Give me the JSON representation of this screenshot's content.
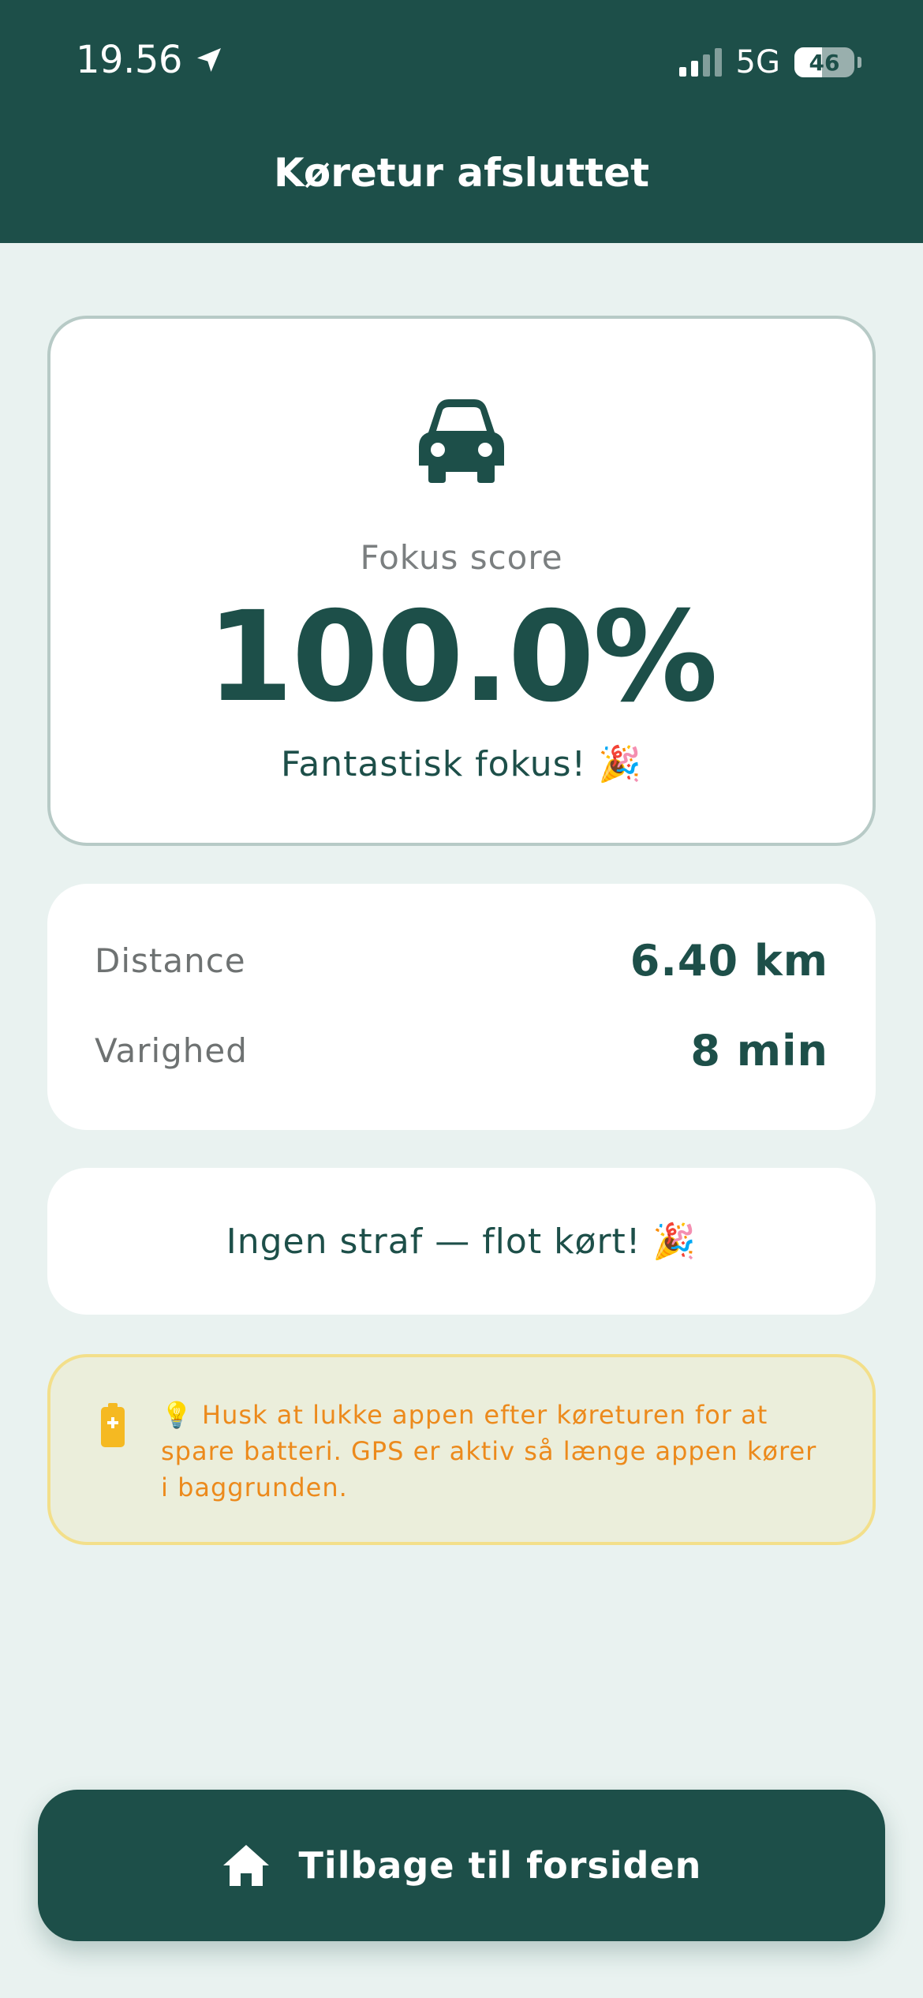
{
  "status_bar": {
    "time": "19.56",
    "network": "5G",
    "battery_percent": "46",
    "battery_level": 0.46,
    "signal_bars_active": 2,
    "signal_bars_total": 4
  },
  "header": {
    "title": "Køretur afsluttet"
  },
  "score_card": {
    "icon": "car-icon",
    "label": "Fokus score",
    "value": "100.0%",
    "message": "Fantastisk fokus! 🎉"
  },
  "stats": {
    "distance_label": "Distance",
    "distance_value": "6.40 km",
    "duration_label": "Varighed",
    "duration_value": "8 min"
  },
  "penalty": {
    "text": "Ingen straf — flot kørt! 🎉"
  },
  "tip": {
    "icon": "battery-icon",
    "text": "💡 Husk at lukke appen efter køreturen for at spare batteri. GPS er aktiv så længe appen kører i baggrunden."
  },
  "home_button": {
    "icon": "home-icon",
    "label": "Tilbage til forsiden"
  },
  "colors": {
    "primary": "#1d4f49",
    "background": "#e9f2f0",
    "tip_text": "#ec8a1c",
    "tip_background": "#ebeedb",
    "battery_icon": "#f5b922"
  }
}
